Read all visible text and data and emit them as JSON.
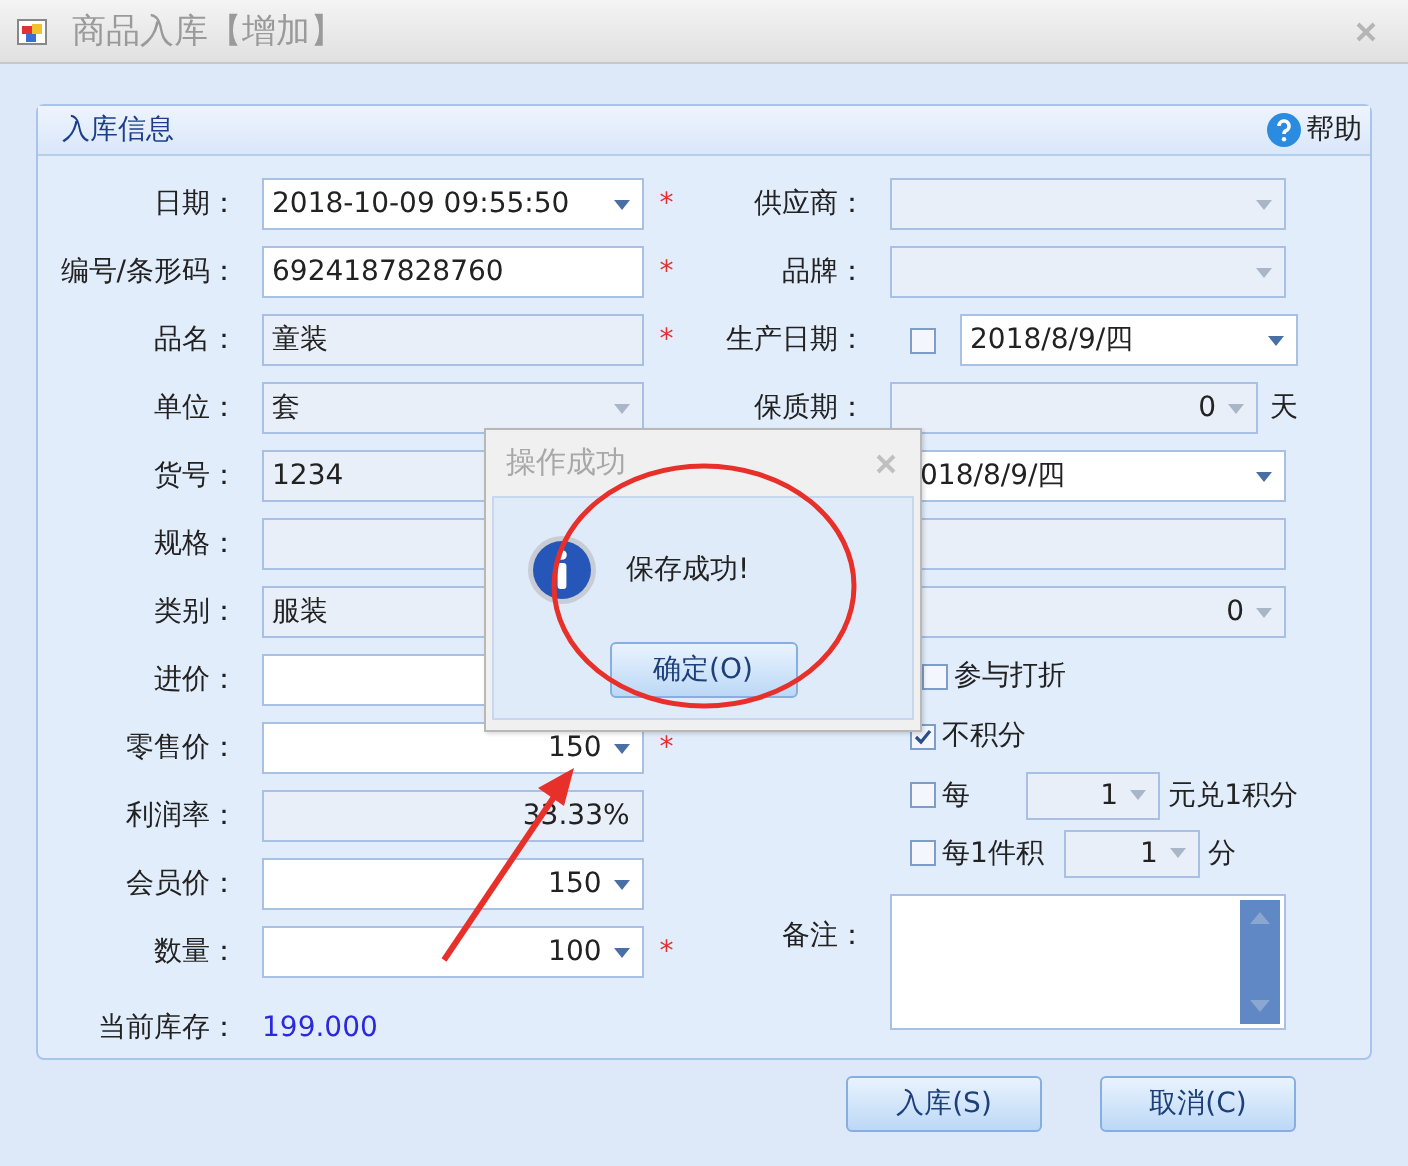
{
  "window": {
    "title": "商品入库【增加】"
  },
  "group": {
    "title": "入库信息",
    "help": "帮助"
  },
  "left_rows": [
    {
      "label": "日期：",
      "kind": "combo",
      "value": "2018-10-09 09:55:50",
      "disabled": false,
      "mark": "*"
    },
    {
      "label": "编号/条形码：",
      "kind": "text",
      "value": "6924187828760",
      "disabled": false,
      "mark": "*"
    },
    {
      "label": "品名：",
      "kind": "text",
      "value": "童装",
      "disabled": true,
      "mark": "*"
    },
    {
      "label": "单位：",
      "kind": "combo",
      "value": "套",
      "disabled": true
    },
    {
      "label": "货号：",
      "kind": "text",
      "value": "1234",
      "disabled": true
    },
    {
      "label": "规格：",
      "kind": "text",
      "disabled": true
    },
    {
      "label": "类别：",
      "kind": "combo",
      "value": "服装",
      "disabled": true
    },
    {
      "label": "进价：",
      "kind": "text",
      "disabled": false
    },
    {
      "label": "零售价：",
      "kind": "number",
      "value": "150",
      "disabled": false,
      "mark": "*"
    },
    {
      "label": "利润率：",
      "kind": "readout",
      "value": "33.33%",
      "disabled": true
    },
    {
      "label": "会员价：",
      "kind": "number",
      "value": "150",
      "disabled": false
    },
    {
      "label": "数量：",
      "kind": "number",
      "value": "100",
      "disabled": false,
      "mark": "*"
    }
  ],
  "stock": {
    "label": "当前库存：",
    "value": "199.000"
  },
  "right_rows": [
    {
      "label": "供应商：",
      "kind": "combo",
      "disabled": true
    },
    {
      "label": "品牌：",
      "kind": "combo",
      "disabled": true
    },
    {
      "label": "生产日期：",
      "kind": "checkdate",
      "checked": false,
      "value": "2018/8/9/四",
      "disabled": false
    },
    {
      "label": "保质期：",
      "kind": "number",
      "value": "0",
      "unit": "天",
      "disabled": true
    },
    {
      "kind": "combo",
      "value": "018/8/9/四",
      "disabled": false
    },
    {
      "kind": "text",
      "disabled": true
    },
    {
      "kind": "number",
      "value": "0",
      "disabled": true
    },
    {
      "kind": "check",
      "text": "参与打折",
      "checked": false
    },
    {
      "kind": "check",
      "text": "不积分",
      "checked": true
    },
    {
      "kind": "checkspin",
      "text": "每",
      "value": "1",
      "suffix": "元兑1积分",
      "checked": false
    },
    {
      "kind": "checkspin",
      "text": "每1件积",
      "value": "1",
      "suffix": "分",
      "checked": false
    },
    {
      "label": "备注：",
      "kind": "memo"
    }
  ],
  "buttons": [
    {
      "label": "入库(S)"
    },
    {
      "label": "取消(C)"
    }
  ],
  "dialog": {
    "title": "操作成功",
    "message": "保存成功!",
    "button": "确定(O)"
  }
}
